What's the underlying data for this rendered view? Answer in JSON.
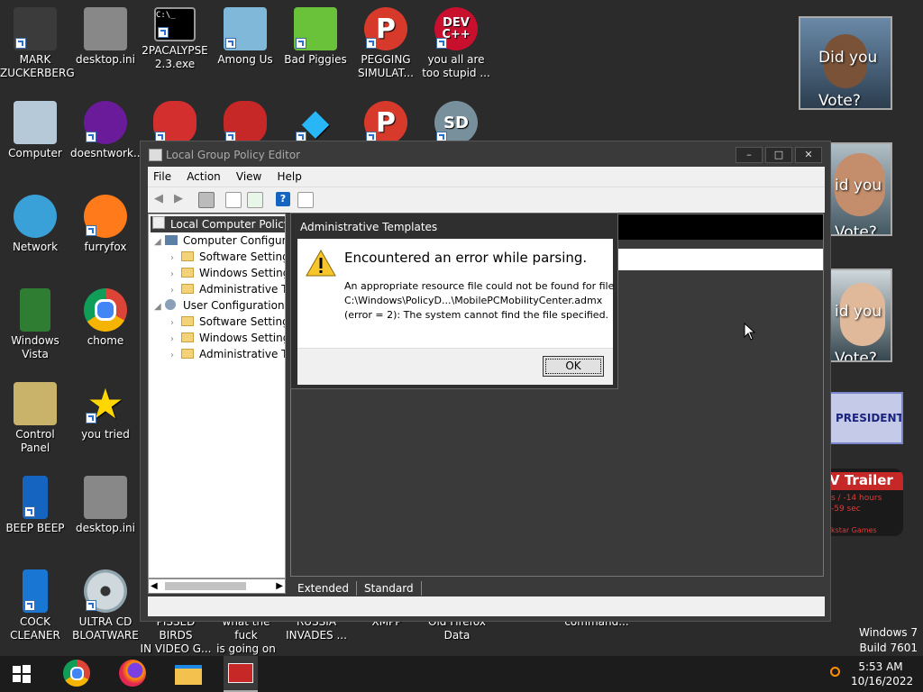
{
  "desktop": {
    "icons": [
      {
        "label": "MARK\nZUCKERBERG",
        "color": "#3b3b3b"
      },
      {
        "label": "desktop.ini",
        "color": "#888888"
      },
      {
        "label": "2PACALYPSE\n2.3.exe",
        "color": "#000000"
      },
      {
        "label": "Among Us",
        "color": "#7fb8d8"
      },
      {
        "label": "Bad Piggies",
        "color": "#6ac13a"
      },
      {
        "label": "PEGGING\nSIMULAT...",
        "color": "#d73a2a"
      },
      {
        "label": "you all are\ntoo stupid ...",
        "color": "#c8102e"
      },
      {
        "label": "Computer",
        "color": "#b6c9d8"
      },
      {
        "label": "doesntwork...",
        "color": "#6a1b9a"
      },
      {
        "label": "Network",
        "color": "#3aa0d8"
      },
      {
        "label": "furryfox",
        "color": "#ff7a1a"
      },
      {
        "label": "Windows\nVista",
        "color": "#2e7d32"
      },
      {
        "label": "chome",
        "color": "#4285f4"
      },
      {
        "label": "Control Panel",
        "color": "#c9b36a"
      },
      {
        "label": "you tried",
        "color": "#ffd600"
      },
      {
        "label": "BEEP BEEP",
        "color": "#1565c0"
      },
      {
        "label": "desktop.ini",
        "color": "#888888"
      },
      {
        "label": "COCK\nCLEANER",
        "color": "#1976d2"
      },
      {
        "label": "ULTRA CD\nBLOATWARE",
        "color": "#cfd8dc"
      }
    ],
    "partial_labels": [
      "PISSED BIRDS\nIN VIDEO G...",
      "what the fuck\nis going on ...",
      "RUSSIA\nINVADES ...",
      "XMPP",
      "Old Firefox\nData",
      "command..."
    ],
    "widgets": {
      "did_you_vote_1": "Did you\nVote?",
      "did_you_vote_2": "id you\nVote?",
      "did_you_vote_3": "id you\nVote?",
      "president": "PRESIDENT",
      "trailer_title": "V Trailer",
      "trailer_line1": "s / -14 hours",
      "trailer_line2": "-59 sec",
      "trailer_footer": "kstar Games"
    }
  },
  "window": {
    "title": "Local Group Policy Editor",
    "minimize": "–",
    "maximize": "□",
    "close": "✕",
    "menu": [
      "File",
      "Action",
      "View",
      "Help"
    ],
    "tree": {
      "root": "Local Computer Policy",
      "computer_config": "Computer Configura",
      "cc_software": "Software Settings",
      "cc_windows": "Windows Setting",
      "cc_admin": "Administrative Te",
      "user_config": "User Configuration",
      "uc_software": "Software Settings",
      "uc_windows": "Windows Setting",
      "uc_admin": "Administrative Te"
    },
    "tabs": [
      "Extended",
      "Standard"
    ]
  },
  "dialog": {
    "title": "Administrative Templates",
    "heading": "Encountered an error while parsing.",
    "message_line1": "An appropriate resource file could not be found for file",
    "message_line2": "C:\\Windows\\PolicyD...\\MobilePCMobilityCenter.admx",
    "message_line3": "(error = 2): The system cannot find the file specified.",
    "ok": "OK"
  },
  "watermark": {
    "line1": "Windows 7",
    "line2": "Build 7601"
  },
  "taskbar": {
    "time": "5:53 AM",
    "date": "10/16/2022"
  }
}
